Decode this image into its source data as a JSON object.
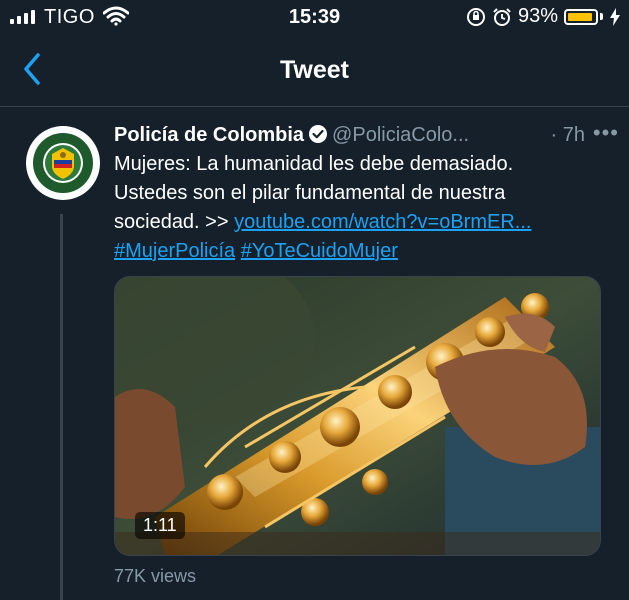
{
  "status_bar": {
    "carrier": "TIGO",
    "time": "15:39",
    "battery_percent": "93%",
    "battery_level": 0.93,
    "icons": [
      "signal-icon",
      "wifi-icon",
      "orientation-lock-icon",
      "alarm-icon",
      "battery-icon",
      "charging-icon"
    ]
  },
  "nav": {
    "title": "Tweet",
    "back_icon": "chevron-left-icon"
  },
  "tweet": {
    "author_name": "Policía de Colombia",
    "handle": "@PoliciaColo...",
    "time": "· 7h",
    "more_label": "•••",
    "text_line1": "Mujeres: La humanidad les debe demasiado.",
    "text_line2": "Ustedes son el pilar fundamental de nuestra",
    "text_line3_prefix": "sociedad. >> ",
    "link": "youtube.com/watch?v=oBrmER...",
    "hashtag1": "#MujerPolicía",
    "hashtag2": "#YoTeCuidoMujer",
    "video_duration": "1:11",
    "views": "77K views"
  },
  "colors": {
    "background": "#15202b",
    "link": "#1da1f2",
    "secondary_text": "#8899a6",
    "battery": "#ffc107"
  }
}
